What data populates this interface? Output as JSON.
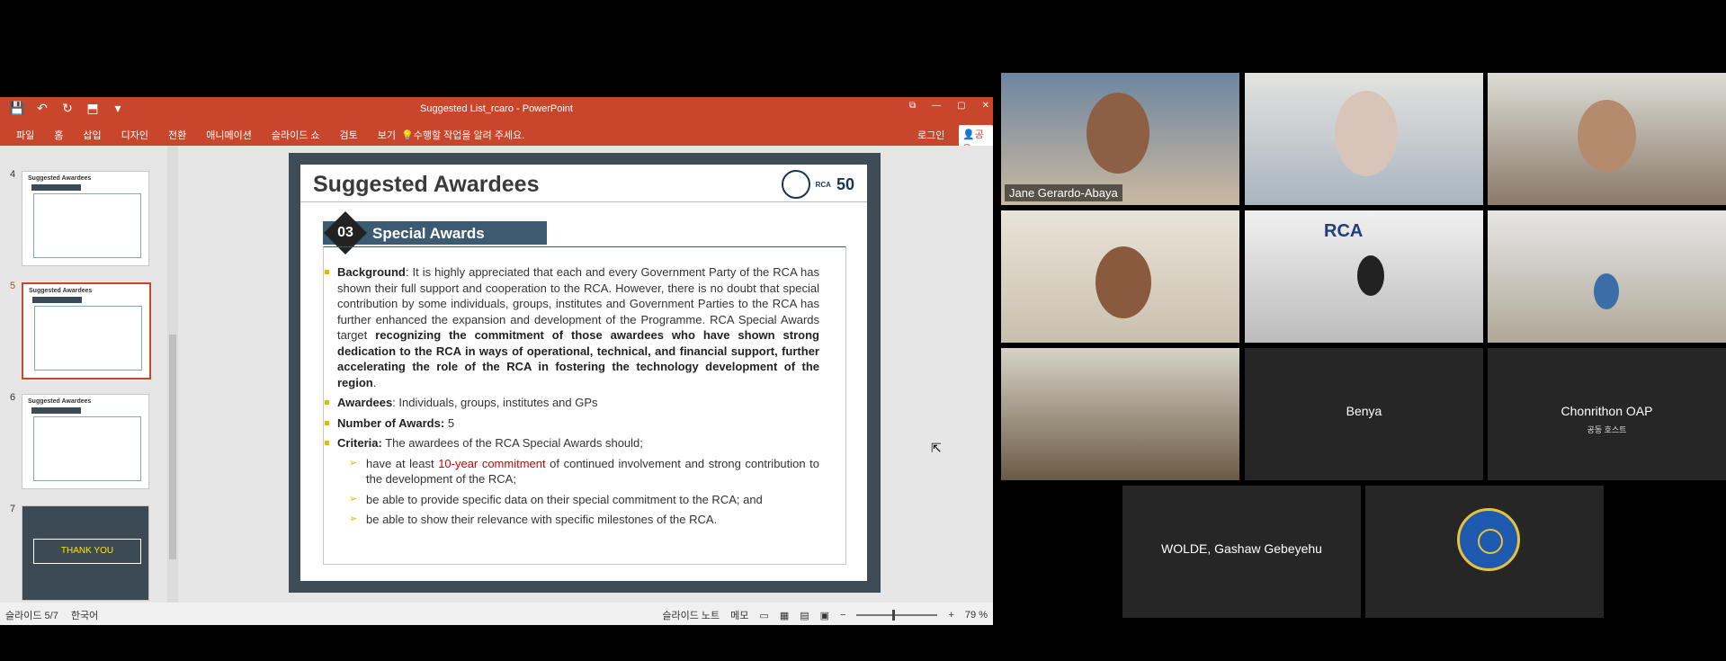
{
  "ppt": {
    "title": "Suggested List_rcaro - PowerPoint",
    "qat": [
      "💾",
      "↶",
      "↻",
      "⬒",
      "▾"
    ],
    "window_controls": [
      "⧉",
      "—",
      "▢",
      "✕"
    ],
    "tabs": [
      "파일",
      "홈",
      "삽입",
      "디자인",
      "전환",
      "애니메이션",
      "슬라이드 쇼",
      "검토",
      "보기"
    ],
    "tell_me": "수행할 작업을 알려 주세요.",
    "login": "로그인",
    "share": "공유",
    "thumbnails": [
      {
        "num": "4",
        "title": "Suggested Awardees"
      },
      {
        "num": "5",
        "title": "Suggested Awardees"
      },
      {
        "num": "6",
        "title": "Suggested Awardees"
      },
      {
        "num": "7",
        "title": "THANK YOU"
      }
    ],
    "slide": {
      "title": "Suggested Awardees",
      "logo_text": "RCA",
      "logo_50": "50",
      "section_number": "03",
      "section_label": "Special Awards",
      "background_label": "Background",
      "background_text": ": It is highly appreciated that each and every Government Party of the RCA has shown their full support and cooperation to the RCA. However, there is no doubt that special contribution by some individuals, groups, institutes and Government Parties to the RCA has further enhanced the expansion and development of the Programme. RCA Special Awards target ",
      "background_bold": "recognizing the commitment of those awardees who have shown strong dedication to the RCA in ways of operational, technical, and financial support, further accelerating the role of the RCA in fostering the technology development of the region",
      "background_end": ".",
      "awardees_label": "Awardees",
      "awardees_text": ": Individuals, groups, institutes and GPs",
      "number_label": "Number of Awards:",
      "number_value": "5",
      "criteria_label": "Criteria:",
      "criteria_text": " The awardees of the RCA Special Awards should;",
      "sub1_a": "have at least ",
      "sub1_red": "10-year commitment",
      "sub1_b": " of continued involvement and strong contribution to the development of the RCA;",
      "sub2": "be able to provide specific data on their special commitment to the RCA; and",
      "sub3": "be able to show their relevance with specific milestones of the RCA."
    },
    "status": {
      "slide_info": "슬라이드 5/7",
      "language": "한국어",
      "notes": "슬라이드 노트",
      "comments": "메모",
      "zoom": "79 %"
    }
  },
  "video": {
    "speaker_label": "Jane Gerardo-Abaya",
    "benya": "Benya",
    "chonrithon": "Chonrithon OAP",
    "chonrithon_sub": "공동 호스트",
    "wolde": "WOLDE, Gashaw Gebeyehu",
    "room_sign": "RCA"
  }
}
